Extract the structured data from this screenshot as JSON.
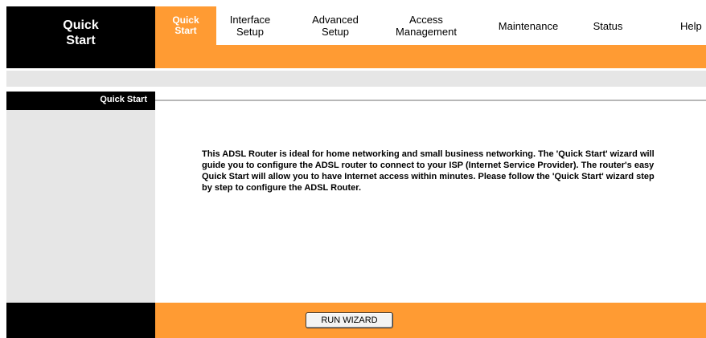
{
  "header": {
    "title_line1": "Quick",
    "title_line2": "Start"
  },
  "nav": {
    "tabs": [
      {
        "line1": "Quick",
        "line2": "Start",
        "active": true
      },
      {
        "line1": "Interface",
        "line2": "Setup"
      },
      {
        "line1": "Advanced",
        "line2": "Setup"
      },
      {
        "line1": "Access",
        "line2": "Management"
      },
      {
        "line1": "Maintenance",
        "line2": ""
      },
      {
        "line1": "Status",
        "line2": ""
      },
      {
        "line1": "Help",
        "line2": ""
      }
    ]
  },
  "section": {
    "label": "Quick Start"
  },
  "main": {
    "description": "This ADSL Router is ideal for home networking and small business networking. The 'Quick Start' wizard will guide you to configure the ADSL router to connect to your ISP (Internet Service Provider). The router's easy Quick Start will allow you to have Internet access within minutes. Please follow the 'Quick Start' wizard step by step to configure the ADSL Router."
  },
  "footer": {
    "run_wizard_label": "RUN WIZARD"
  },
  "colors": {
    "accent": "#ff9b33",
    "panel_gray": "#e6e6e6",
    "black": "#000000"
  }
}
